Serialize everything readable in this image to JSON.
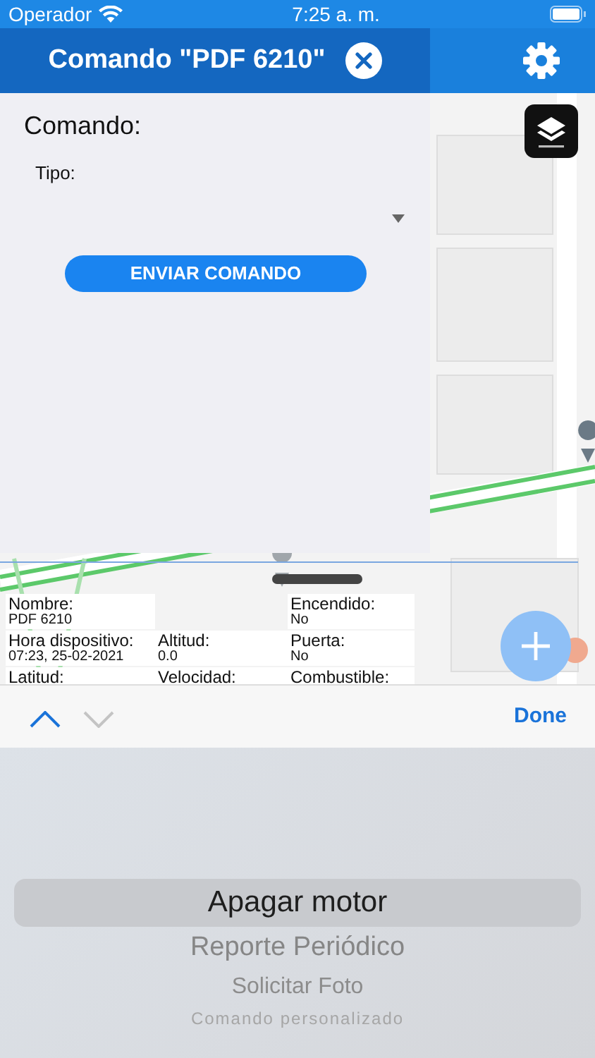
{
  "status_bar": {
    "carrier": "Operador",
    "time": "7:25 a. m."
  },
  "header": {
    "title": "Comando \"PDF 6210\""
  },
  "command_panel": {
    "heading": "Comando:",
    "type_label": "Tipo:",
    "send_button": "ENVIAR COMANDO"
  },
  "vehicle_info": [
    [
      {
        "label": "Nombre:",
        "value": "PDF 6210"
      },
      {
        "kind": "empty"
      },
      {
        "label": "Encendido:",
        "value": "No"
      }
    ],
    [
      {
        "label": "Hora dispositivo:",
        "value": "07:23, 25-02-2021"
      },
      {
        "label": "Altitud:",
        "value": "0.0"
      },
      {
        "label": "Puerta:",
        "value": "No"
      }
    ],
    [
      {
        "label": "Latitud:"
      },
      {
        "label": "Velocidad:"
      },
      {
        "label": "Combustible:"
      }
    ]
  ],
  "keyboard_toolbar": {
    "previous": {
      "disabled": false
    },
    "next": {
      "disabled": true
    },
    "done": "Done"
  },
  "picker": {
    "options": [
      {
        "label": "Apagar motor",
        "selected": true
      },
      {
        "label": "Reporte Periódico",
        "selected": false
      },
      {
        "label": "Solicitar Foto",
        "selected": false
      },
      {
        "label": "Comando personalizado",
        "selected": false
      }
    ]
  }
}
